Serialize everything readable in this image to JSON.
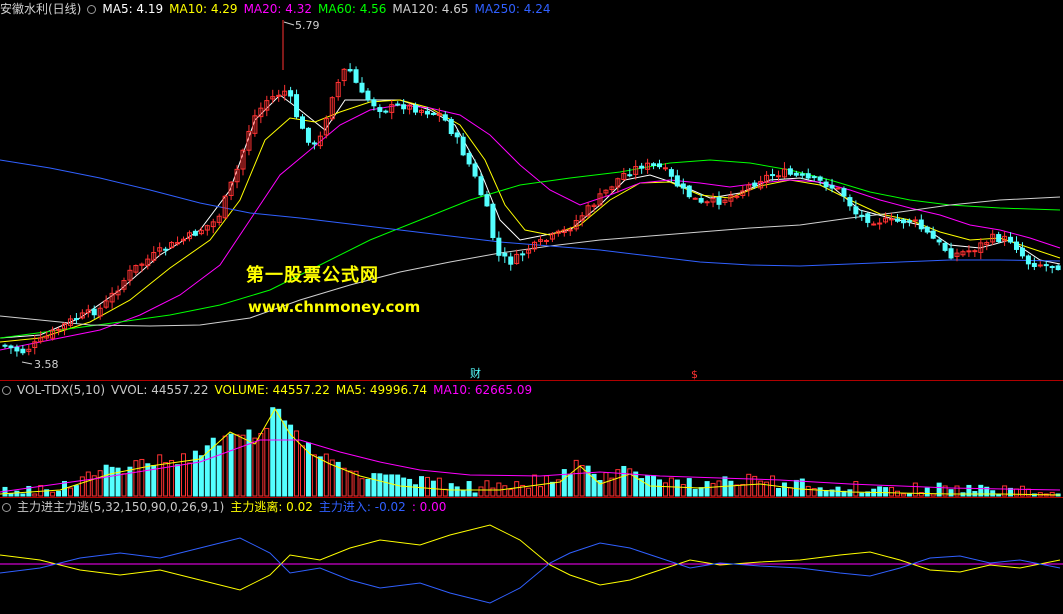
{
  "main_header": {
    "title": "安徽水利(日线)",
    "items": [
      {
        "text": "MA5: 4.19",
        "color": "#ffffff"
      },
      {
        "text": "MA10: 4.29",
        "color": "#ffff00"
      },
      {
        "text": "MA20: 4.32",
        "color": "#ff00ff"
      },
      {
        "text": "MA60: 4.56",
        "color": "#00ff00"
      },
      {
        "text": "MA120: 4.65",
        "color": "#d0d0d0"
      },
      {
        "text": "MA250: 4.24",
        "color": "#3060ff"
      }
    ]
  },
  "price_labels": {
    "high": "5.79",
    "low": "3.58"
  },
  "event_markers": {
    "cai": "财",
    "s": "$"
  },
  "watermark": {
    "line1": "第一股票公式网",
    "line2": "www.chnmoney.com"
  },
  "vol_header": {
    "items": [
      {
        "text": "VOL-TDX(5,10)",
        "color": "#c8c8c8"
      },
      {
        "text": "VVOL: 44557.22",
        "color": "#c8c8c8"
      },
      {
        "text": "VOLUME: 44557.22",
        "color": "#ffff00"
      },
      {
        "text": "MA5: 49996.74",
        "color": "#ffff00"
      },
      {
        "text": "MA10: 62665.09",
        "color": "#ff00ff"
      }
    ]
  },
  "ind_header": {
    "items": [
      {
        "text": "主力进主力逃(5,32,150,90,0,26,9,1)",
        "color": "#c8c8c8"
      },
      {
        "text": "主力逃离: 0.02",
        "color": "#ffff00"
      },
      {
        "text": "主力进入: -0.02",
        "color": "#3060ff"
      },
      {
        "text": ": 0.00",
        "color": "#ff00ff"
      }
    ]
  },
  "colors": {
    "up": "#ff3232",
    "down": "#54ffff",
    "ma5": "#ffffff",
    "ma10": "#ffff00",
    "ma20": "#ff00ff",
    "ma60": "#00ff00",
    "ma120": "#d0d0d0",
    "ma250": "#3060ff",
    "separator": "#b00000"
  }
}
